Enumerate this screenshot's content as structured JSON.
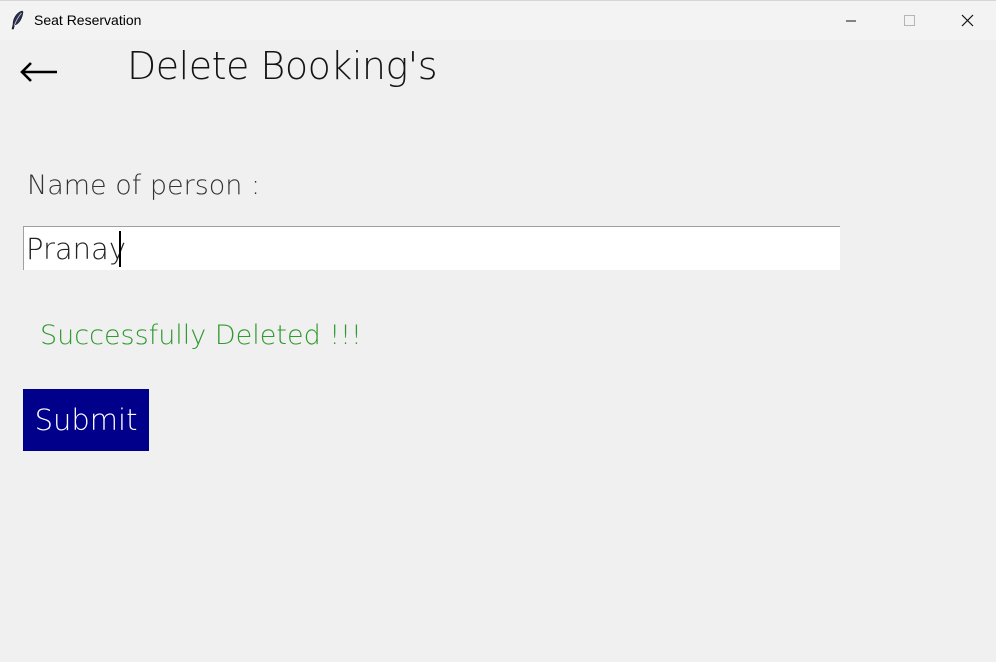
{
  "window": {
    "title": "Seat Reservation",
    "icon": "feather-icon",
    "controls": [
      "minimize-icon",
      "maximize-icon",
      "close-icon"
    ]
  },
  "header": {
    "back_icon": "arrow-left-icon",
    "back_glyph": "⟵",
    "title": "Delete Booking's"
  },
  "form": {
    "name_label": "Name of person :",
    "name_value": "Pranay",
    "status_message": "Successfully Deleted !!!",
    "submit_label": "Submit"
  },
  "colors": {
    "background": "#f0f0f0",
    "success": "#2f9a2f",
    "button": "#00008b",
    "button_text": "#ffffff"
  }
}
